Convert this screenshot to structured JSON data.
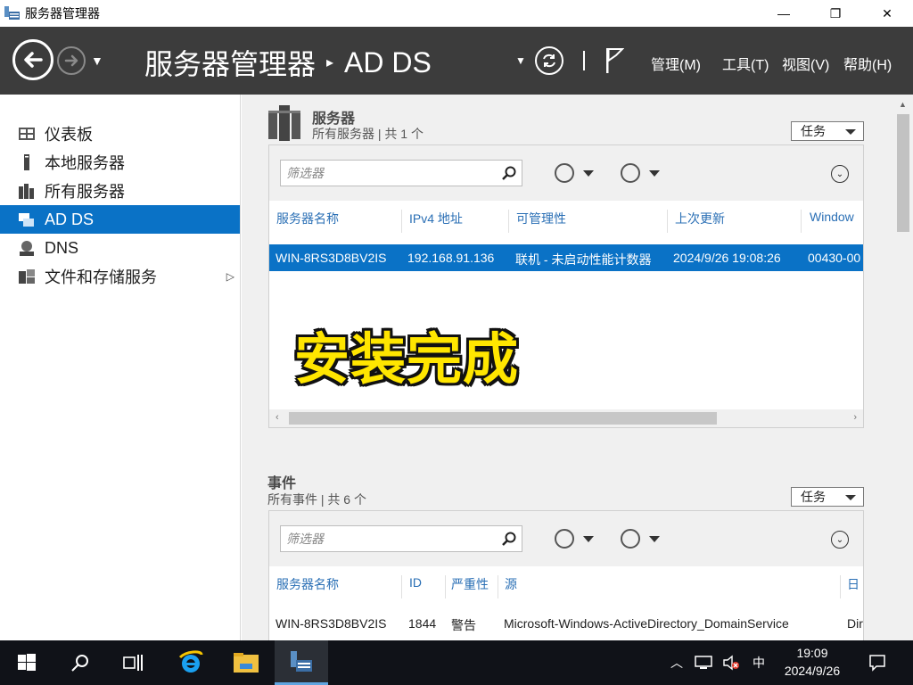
{
  "window": {
    "title": "服务器管理器",
    "minimize": "—",
    "maximize": "❐",
    "close": "✕"
  },
  "header": {
    "breadcrumb_root": "服务器管理器",
    "breadcrumb_sep": "▸",
    "breadcrumb_current": "AD DS",
    "menus": [
      {
        "label": "管理(M)"
      },
      {
        "label": "工具(T)"
      },
      {
        "label": "视图(V)"
      },
      {
        "label": "帮助(H)"
      }
    ]
  },
  "sidebar": {
    "items": [
      {
        "label": "仪表板",
        "icon": "dashboard-icon"
      },
      {
        "label": "本地服务器",
        "icon": "server-icon"
      },
      {
        "label": "所有服务器",
        "icon": "servers-icon"
      },
      {
        "label": "AD DS",
        "icon": "ad-ds-icon",
        "active": true
      },
      {
        "label": "DNS",
        "icon": "dns-icon"
      },
      {
        "label": "文件和存储服务",
        "icon": "storage-icon",
        "arrow": "▷"
      }
    ]
  },
  "servers": {
    "title": "服务器",
    "subtitle": "所有服务器 | 共 1 个",
    "task_label": "任务",
    "filter_placeholder": "筛选器",
    "columns": [
      "服务器名称",
      "IPv4 地址",
      "可管理性",
      "上次更新",
      "Window"
    ],
    "rows": [
      {
        "name": "WIN-8RS3D8BV2IS",
        "ipv4": "192.168.91.136",
        "manageability": "联机 - 未启动性能计数器",
        "last_update": "2024/9/26 19:08:26",
        "windows": "00430-00"
      }
    ]
  },
  "overlay": {
    "text": "安装完成"
  },
  "events": {
    "title": "事件",
    "subtitle": "所有事件 | 共 6 个",
    "task_label": "任务",
    "filter_placeholder": "筛选器",
    "columns": [
      "服务器名称",
      "ID",
      "严重性",
      "源",
      "日"
    ],
    "rows": [
      {
        "name": "WIN-8RS3D8BV2IS",
        "id": "1844",
        "severity": "警告",
        "source": "Microsoft-Windows-ActiveDirectory_DomainService",
        "date": "Dir"
      }
    ]
  },
  "taskbar": {
    "ime": "中",
    "time": "19:09",
    "date": "2024/9/26"
  },
  "colors": {
    "accent": "#0a72c6",
    "header_bg": "#3c3c3c",
    "overlay_text": "#ffe600"
  }
}
